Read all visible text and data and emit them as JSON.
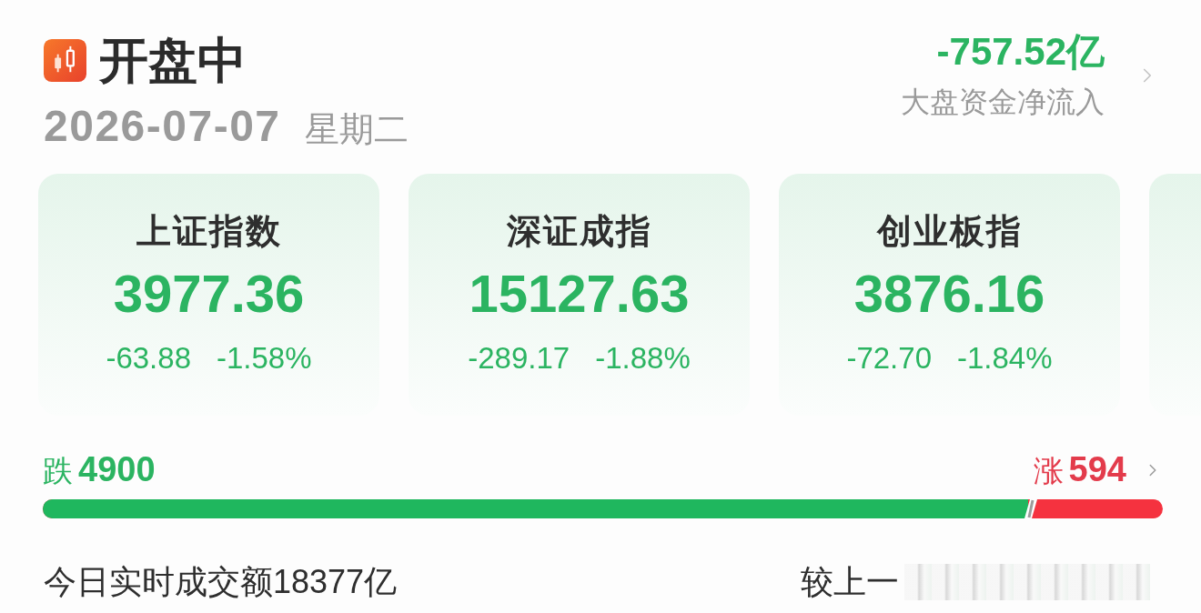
{
  "header": {
    "title": "开盘中",
    "date": "2026-07-07",
    "weekday": "星期二",
    "net_inflow": {
      "value": "-757.52亿",
      "label": "大盘资金净流入",
      "rising": false
    }
  },
  "indices": [
    {
      "name": "上证指数",
      "value": "3977.36",
      "change": "-63.88",
      "change_pct": "-1.58%",
      "rising": false
    },
    {
      "name": "深证成指",
      "value": "15127.63",
      "change": "-289.17",
      "change_pct": "-1.88%",
      "rising": false
    },
    {
      "name": "创业板指",
      "value": "3876.16",
      "change": "-72.70",
      "change_pct": "-1.84%",
      "rising": false
    }
  ],
  "breadth": {
    "down_label": "跌",
    "down_count": "4900",
    "up_label": "涨",
    "up_count": "594",
    "level": 0.88
  },
  "turnover": {
    "text": "今日实时成交额18377亿",
    "comparison": "较上一"
  }
}
